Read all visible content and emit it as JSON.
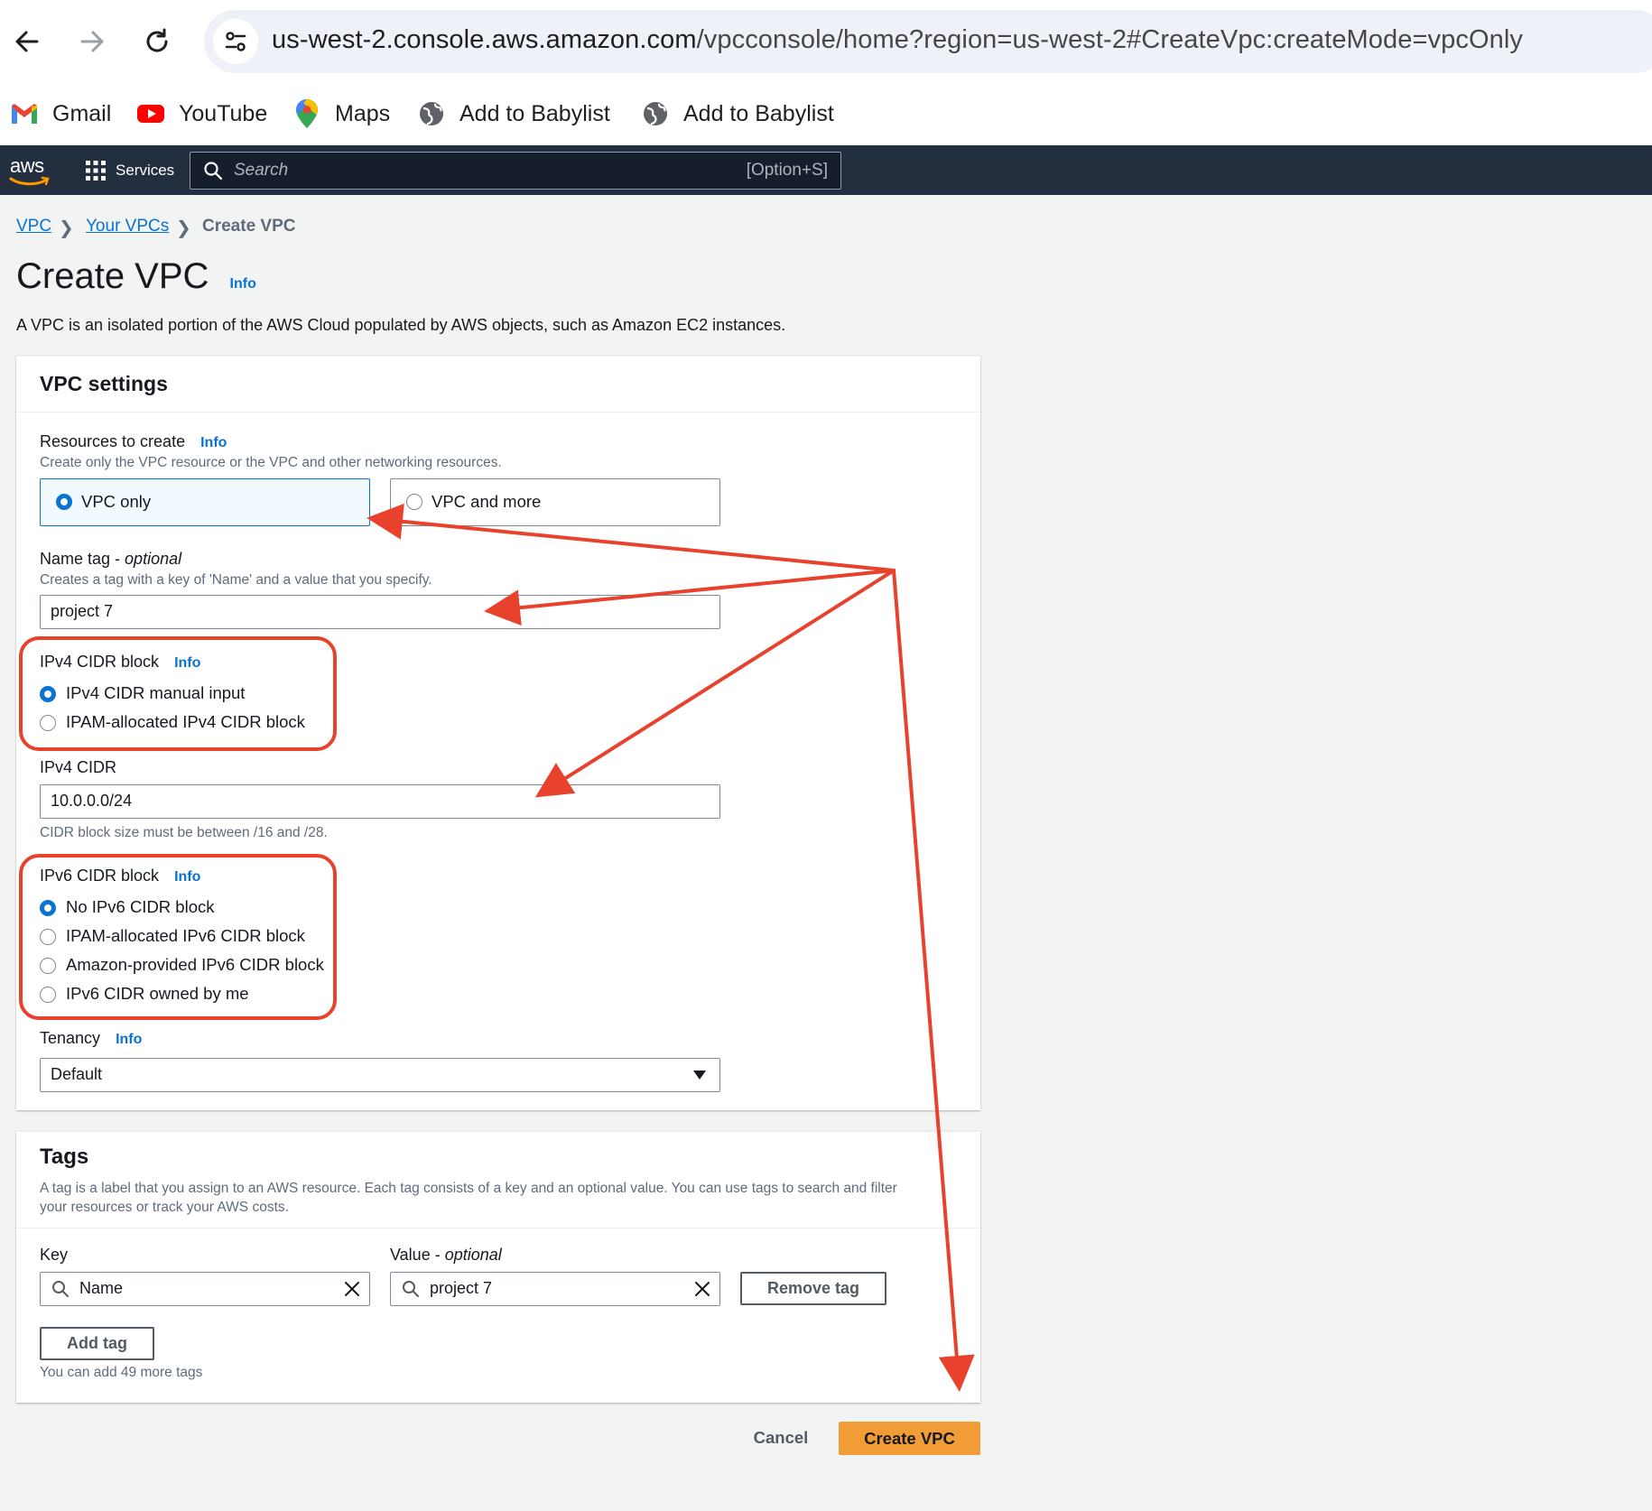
{
  "browser": {
    "url_host": "us-west-2.console.aws.amazon.com",
    "url_rest": "/vpcconsole/home?region=us-west-2#CreateVpc:createMode=vpcOnly",
    "bookmarks": [
      {
        "label": "Gmail",
        "icon": "gmail-icon"
      },
      {
        "label": "YouTube",
        "icon": "youtube-icon"
      },
      {
        "label": "Maps",
        "icon": "maps-icon"
      },
      {
        "label": "Add to Babylist",
        "icon": "globe-icon"
      },
      {
        "label": "Add to Babylist",
        "icon": "globe-icon"
      }
    ]
  },
  "aws_header": {
    "logo": "aws",
    "services_label": "Services",
    "search_placeholder": "Search",
    "search_shortcut": "[Option+S]"
  },
  "breadcrumb": {
    "items": [
      "VPC",
      "Your VPCs",
      "Create VPC"
    ]
  },
  "page": {
    "title": "Create VPC",
    "info": "Info",
    "description": "A VPC is an isolated portion of the AWS Cloud populated by AWS objects, such as Amazon EC2 instances."
  },
  "vpc_settings": {
    "title": "VPC settings",
    "resources": {
      "label": "Resources to create",
      "info": "Info",
      "description": "Create only the VPC resource or the VPC and other networking resources.",
      "options": [
        "VPC only",
        "VPC and more"
      ],
      "selected": "VPC only"
    },
    "name_tag": {
      "label": "Name tag - ",
      "label_italic": "optional",
      "description": "Creates a tag with a key of 'Name' and a value that you specify.",
      "value": "project 7"
    },
    "ipv4_block": {
      "label": "IPv4 CIDR block",
      "info": "Info",
      "options": [
        "IPv4 CIDR manual input",
        "IPAM-allocated IPv4 CIDR block"
      ],
      "selected": "IPv4 CIDR manual input"
    },
    "ipv4_cidr": {
      "label": "IPv4 CIDR",
      "value": "10.0.0.0/24",
      "constraint": "CIDR block size must be between /16 and /28."
    },
    "ipv6_block": {
      "label": "IPv6 CIDR block",
      "info": "Info",
      "options": [
        "No IPv6 CIDR block",
        "IPAM-allocated IPv6 CIDR block",
        "Amazon-provided IPv6 CIDR block",
        "IPv6 CIDR owned by me"
      ],
      "selected": "No IPv6 CIDR block"
    },
    "tenancy": {
      "label": "Tenancy",
      "info": "Info",
      "value": "Default"
    }
  },
  "tags": {
    "title": "Tags",
    "description_line1": "A tag is a label that you assign to an AWS resource. Each tag consists of a key and an optional value. You can use tags to search and filter",
    "description_line2": "your resources or track your AWS costs.",
    "key_label": "Key",
    "value_label": "Value - ",
    "value_label_italic": "optional",
    "key_value": "Name",
    "value_value": "project 7",
    "remove_label": "Remove tag",
    "add_label": "Add tag",
    "hint": "You can add 49 more tags"
  },
  "actions": {
    "cancel": "Cancel",
    "create": "Create VPC"
  },
  "colors": {
    "annotation": "#e8412c",
    "primary_button": "#f29c38",
    "link": "#0972d3",
    "aws_header_bg": "#232f3e"
  }
}
